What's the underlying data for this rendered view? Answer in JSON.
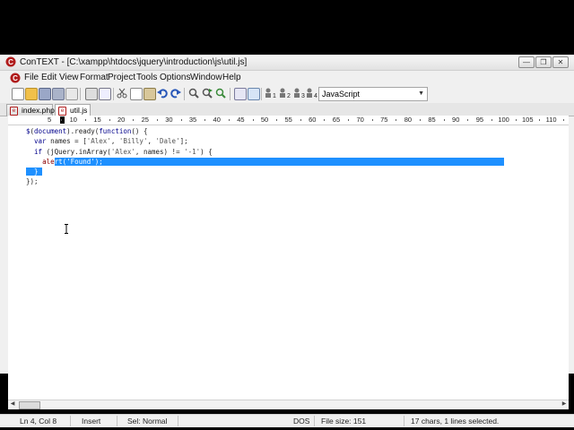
{
  "window": {
    "title": "ConTEXT - [C:\\xampp\\htdocs\\jquery\\introduction\\js\\util.js]",
    "controls": [
      "—",
      "❐",
      "✕"
    ],
    "app_icon": "context-app-icon"
  },
  "menu": [
    "File",
    "Edit",
    "View",
    "Format",
    "Project",
    "Tools",
    "Options",
    "Window",
    "Help"
  ],
  "toolbar": {
    "buttons": [
      "new-file",
      "open-file",
      "save",
      "save-all",
      "close",
      "print",
      "print-preview",
      "cut",
      "copy",
      "paste",
      "undo",
      "redo",
      "find",
      "find-next",
      "replace",
      "indent",
      "toggle-bookmark",
      "bookmark-1",
      "bookmark-2",
      "bookmark-3",
      "bookmark-4"
    ],
    "highlighter": "JavaScript"
  },
  "tabs": [
    {
      "label": "index.php",
      "active": false
    },
    {
      "label": "util.js",
      "active": true
    }
  ],
  "ruler": {
    "labels": [
      "5",
      "10",
      "15",
      "20",
      "25",
      "30",
      "35",
      "40",
      "45",
      "50",
      "55",
      "60",
      "65",
      "70",
      "75",
      "80",
      "85",
      "90",
      "95",
      "100",
      "105",
      "110"
    ]
  },
  "code": {
    "lines": [
      "$(document).ready(function() {",
      "  var names = ['Alex', 'Billy', 'Dale'];",
      "  if (jQuery.inArray('Alex', names) != '-1') {",
      "    alert('Found');",
      "  }",
      "});"
    ],
    "selected_lines": [
      3,
      4
    ]
  },
  "status": {
    "position": "Ln 4, Col 8",
    "mode": "Insert",
    "selection_mode": "Sel: Normal",
    "line_ending": "DOS",
    "file_size": "File size: 151",
    "selection_info": "17 chars, 1 lines selected."
  },
  "colors": {
    "selection": "#1e90ff",
    "keyword": "#00008b",
    "app_accent": "#b01b1b"
  }
}
